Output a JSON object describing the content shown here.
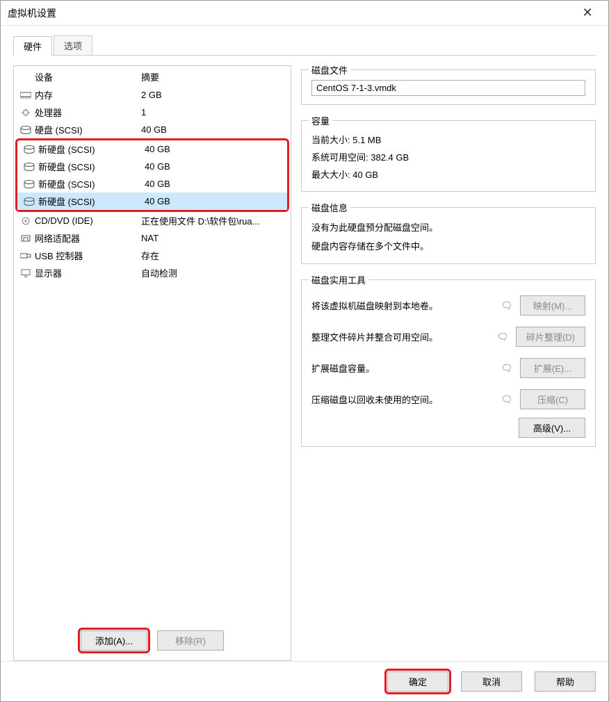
{
  "window": {
    "title": "虚拟机设置"
  },
  "tabs": {
    "hardware": "硬件",
    "options": "选项"
  },
  "columns": {
    "device": "设备",
    "summary": "摘要"
  },
  "devices": [
    {
      "icon": "memory-icon",
      "name": "内存",
      "summary": "2 GB"
    },
    {
      "icon": "cpu-icon",
      "name": "处理器",
      "summary": "1"
    },
    {
      "icon": "disk-icon",
      "name": "硬盘 (SCSI)",
      "summary": "40 GB"
    }
  ],
  "new_disks": [
    {
      "icon": "disk-icon",
      "name": "新硬盘 (SCSI)",
      "summary": "40 GB"
    },
    {
      "icon": "disk-icon",
      "name": "新硬盘 (SCSI)",
      "summary": "40 GB"
    },
    {
      "icon": "disk-icon",
      "name": "新硬盘 (SCSI)",
      "summary": "40 GB"
    },
    {
      "icon": "disk-icon",
      "name": "新硬盘 (SCSI)",
      "summary": "40 GB"
    }
  ],
  "devices_after": [
    {
      "icon": "cd-icon",
      "name": "CD/DVD (IDE)",
      "summary": "正在使用文件 D:\\软件包\\rua..."
    },
    {
      "icon": "net-icon",
      "name": "网络适配器",
      "summary": "NAT"
    },
    {
      "icon": "usb-icon",
      "name": "USB 控制器",
      "summary": "存在"
    },
    {
      "icon": "display-icon",
      "name": "显示器",
      "summary": "自动检测"
    }
  ],
  "left_actions": {
    "add": "添加(A)...",
    "remove": "移除(R)"
  },
  "disk_file": {
    "legend": "磁盘文件",
    "value": "CentOS 7-1-3.vmdk"
  },
  "capacity": {
    "legend": "容量",
    "current_label": "当前大小:",
    "current_value": "5.1 MB",
    "free_label": "系统可用空间:",
    "free_value": "382.4 GB",
    "max_label": "最大大小:",
    "max_value": "40 GB"
  },
  "disk_info": {
    "legend": "磁盘信息",
    "line1": "没有为此硬盘预分配磁盘空间。",
    "line2": "硬盘内容存储在多个文件中。"
  },
  "utilities": {
    "legend": "磁盘实用工具",
    "map_text": "将该虚拟机磁盘映射到本地卷。",
    "map_btn": "映射(M)...",
    "defrag_text": "整理文件碎片并整合可用空间。",
    "defrag_btn": "碎片整理(D)",
    "expand_text": "扩展磁盘容量。",
    "expand_btn": "扩展(E)...",
    "compact_text": "压缩磁盘以回收未使用的空间。",
    "compact_btn": "压缩(C)",
    "advanced_btn": "高级(V)..."
  },
  "footer": {
    "ok": "确定",
    "cancel": "取消",
    "help": "帮助"
  }
}
